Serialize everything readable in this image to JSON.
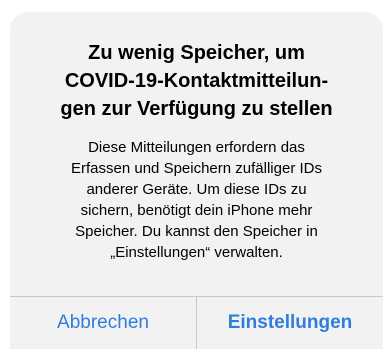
{
  "alert": {
    "title": "Zu wenig Speicher, um\nCOVID-19-Kontaktmitteilun-\ngen zur Verfügung zu stellen",
    "message": "Diese Mitteilungen erfordern das\nErfassen und Speichern zufälliger IDs\nanderer Geräte. Um diese IDs zu\nsichern, benötigt dein iPhone mehr\nSpeicher. Du kannst den Speicher in\n„Einstellungen“ verwalten.",
    "buttons": {
      "cancel_label": "Abbrechen",
      "settings_label": "Einstellungen"
    }
  },
  "colors": {
    "alert_background": "#f2f2f2",
    "button_tint": "#2f7ddc",
    "separator": "#c8c8cc"
  }
}
